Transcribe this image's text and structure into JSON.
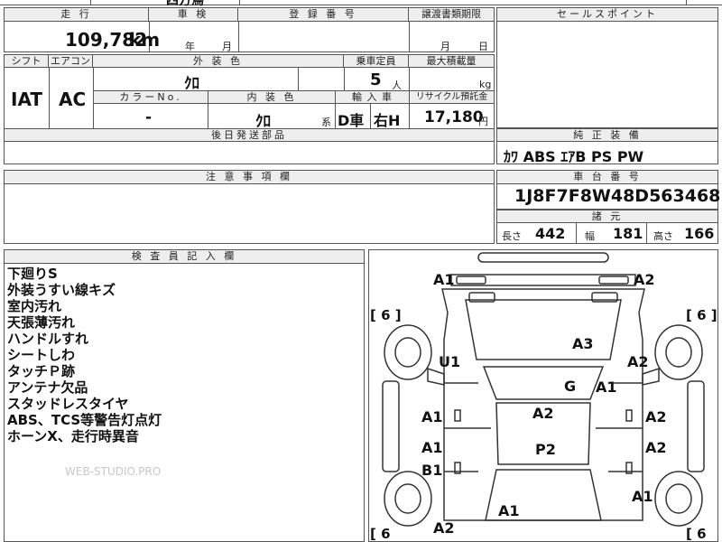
{
  "top_strip": {
    "partial_text": "四方鳥"
  },
  "mileage": {
    "header": "走 行",
    "value": "109,782",
    "unit": "km"
  },
  "inspection": {
    "header": "車 検",
    "year_unit": "年",
    "month_unit": "月"
  },
  "registration": {
    "header": "登 録 番 号"
  },
  "transfer": {
    "header": "譲渡書類期限",
    "month_unit": "月",
    "day_unit": "日"
  },
  "sales_points": {
    "header": "セールスポイント"
  },
  "shift": {
    "header": "シフト",
    "value": "IAT"
  },
  "aircon": {
    "header": "エアコン",
    "value": "AC"
  },
  "exterior_color": {
    "header": "外 装 色",
    "value": "ｸﾛ"
  },
  "capacity": {
    "header": "乗車定員",
    "value": "5",
    "unit": "人"
  },
  "max_load": {
    "header": "最大積載量",
    "unit": "kg"
  },
  "color_no": {
    "header": "カラーNo.",
    "value": "-"
  },
  "interior_color": {
    "header": "内 装 色",
    "value": "ｸﾛ",
    "suffix": "系"
  },
  "import": {
    "header": "輸 入 車",
    "value1": "D車",
    "value2": "右H"
  },
  "recycle": {
    "header": "リサイクル預託金",
    "value": "17,180",
    "unit": "円"
  },
  "later_parts": {
    "header": "後日発送部品"
  },
  "equipment": {
    "header": "純 正 装 備",
    "value": "ｶﾜ ABS ｴｱB PS PW"
  },
  "caution": {
    "header": "注 意 事 項 欄"
  },
  "chassis": {
    "header": "車 台 番 号",
    "value": "1J8F7F8W48D563468"
  },
  "specs": {
    "header": "諸 元",
    "length_label": "長さ",
    "length_value": "442",
    "width_label": "幅",
    "width_value": "181",
    "height_label": "高さ",
    "height_value": "166"
  },
  "inspector": {
    "header": "検 査 員 記 入 欄",
    "notes": [
      "下廻りS",
      "外装うすい線キズ",
      "室内汚れ",
      "天張薄汚れ",
      "ハンドルすれ",
      "シートしわ",
      "タッチＰ跡",
      "アンテナ欠品",
      "スタッドレスタイヤ",
      "ABS、TCS等警告灯点灯",
      "ホーンX、走行時異音"
    ],
    "watermark": "WEB-STUDIO.PRO"
  },
  "car_map": {
    "labels": {
      "front_left": "A1",
      "front_right": "A2",
      "tire_fl": "[ 6 ]",
      "tire_fr": "[ 6 ]",
      "tire_rl": "[ 6",
      "tire_rr": "[ 6",
      "hood": "A3",
      "left_fender": "U1",
      "right_fender": "A2",
      "windshield": "G",
      "right_pillar": "A1",
      "left_front_door": "A1",
      "roof": "A2",
      "right_front_door": "A2",
      "left_rear_door": "A1",
      "rear_seat": "P2",
      "right_rear_door": "A2",
      "left_rear_lower": "B1",
      "right_quarter": "A1",
      "rear_window": "A1",
      "left_rear_quarter": "A2"
    }
  }
}
